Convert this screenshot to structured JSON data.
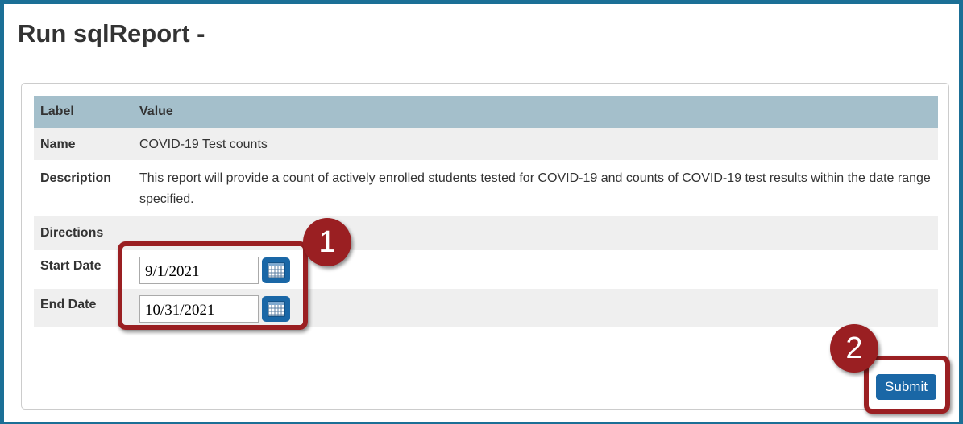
{
  "page": {
    "title": "Run sqlReport -"
  },
  "table": {
    "headers": {
      "label": "Label",
      "value": "Value"
    },
    "rows": {
      "name": {
        "label": "Name",
        "value": "COVID-19 Test counts"
      },
      "description": {
        "label": "Description",
        "value": "This report will provide a count of actively enrolled students tested for COVID-19 and counts of COVID-19 test results within the date range specified."
      },
      "directions": {
        "label": "Directions",
        "value": ""
      },
      "start_date": {
        "label": "Start Date",
        "value": "9/1/2021"
      },
      "end_date": {
        "label": "End Date",
        "value": "10/31/2021"
      }
    }
  },
  "icons": {
    "calendar": "calendar-icon"
  },
  "annotations": {
    "step1": "1",
    "step2": "2"
  },
  "actions": {
    "submit_label": "Submit"
  },
  "colors": {
    "frame": "#1b6f96",
    "header_bg": "#a4bfcb",
    "button": "#1a67a6",
    "highlight": "#9a1f22"
  }
}
